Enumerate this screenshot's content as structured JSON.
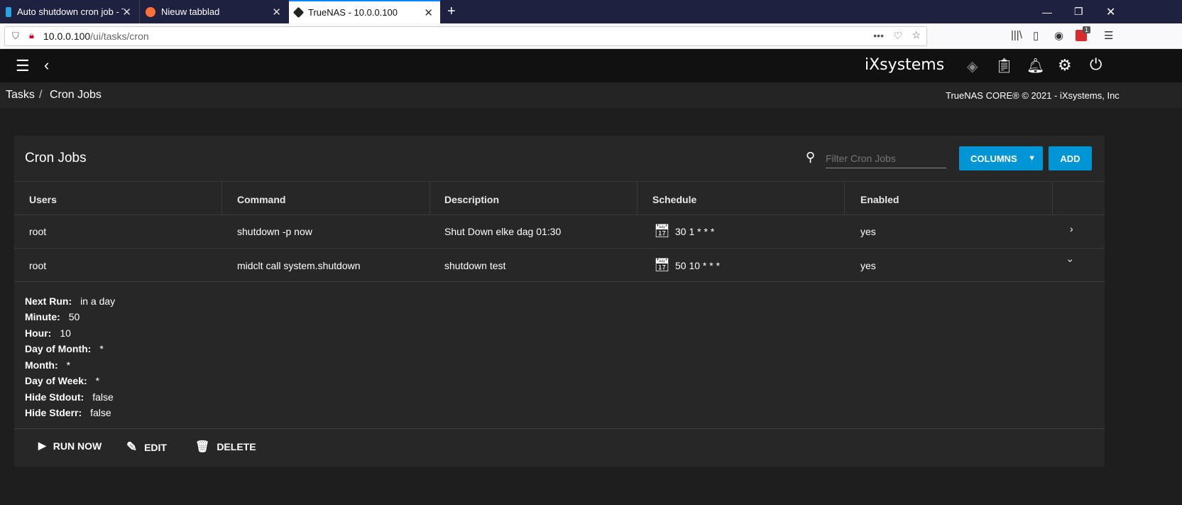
{
  "browser": {
    "tabs": [
      {
        "title": "Auto shutdown cron job - TrueNAS"
      },
      {
        "title": "Nieuw tabblad"
      },
      {
        "title": "TrueNAS - 10.0.0.100"
      }
    ],
    "url_host": "10.0.0.100",
    "url_path": "/ui/tasks/cron",
    "ext_badge": "1"
  },
  "app": {
    "logo": "iXsystems",
    "breadcrumb": [
      "Tasks",
      "Cron Jobs"
    ],
    "copyright": "TrueNAS CORE® © 2021 - iXsystems, Inc"
  },
  "card": {
    "title": "Cron Jobs",
    "filter_placeholder": "Filter Cron Jobs",
    "columns_label": "COLUMNS",
    "add_label": "ADD",
    "headers": [
      "Users",
      "Command",
      "Description",
      "Schedule",
      "Enabled"
    ],
    "rows": [
      {
        "user": "root",
        "command": "shutdown -p now",
        "description": "Shut Down elke dag 01:30",
        "schedule": "30 1 * * *",
        "enabled": "yes"
      },
      {
        "user": "root",
        "command": "midclt call system.shutdown",
        "description": "shutdown test",
        "schedule": "50 10 * * *",
        "enabled": "yes"
      }
    ],
    "details": [
      {
        "k": "Next Run:",
        "v": "in a day"
      },
      {
        "k": "Minute:",
        "v": "50"
      },
      {
        "k": "Hour:",
        "v": "10"
      },
      {
        "k": "Day of Month:",
        "v": "*"
      },
      {
        "k": "Month:",
        "v": "*"
      },
      {
        "k": "Day of Week:",
        "v": "*"
      },
      {
        "k": "Hide Stdout:",
        "v": "false"
      },
      {
        "k": "Hide Stderr:",
        "v": "false"
      }
    ],
    "actions": {
      "run": "RUN NOW",
      "edit": "EDIT",
      "delete": "DELETE"
    }
  }
}
